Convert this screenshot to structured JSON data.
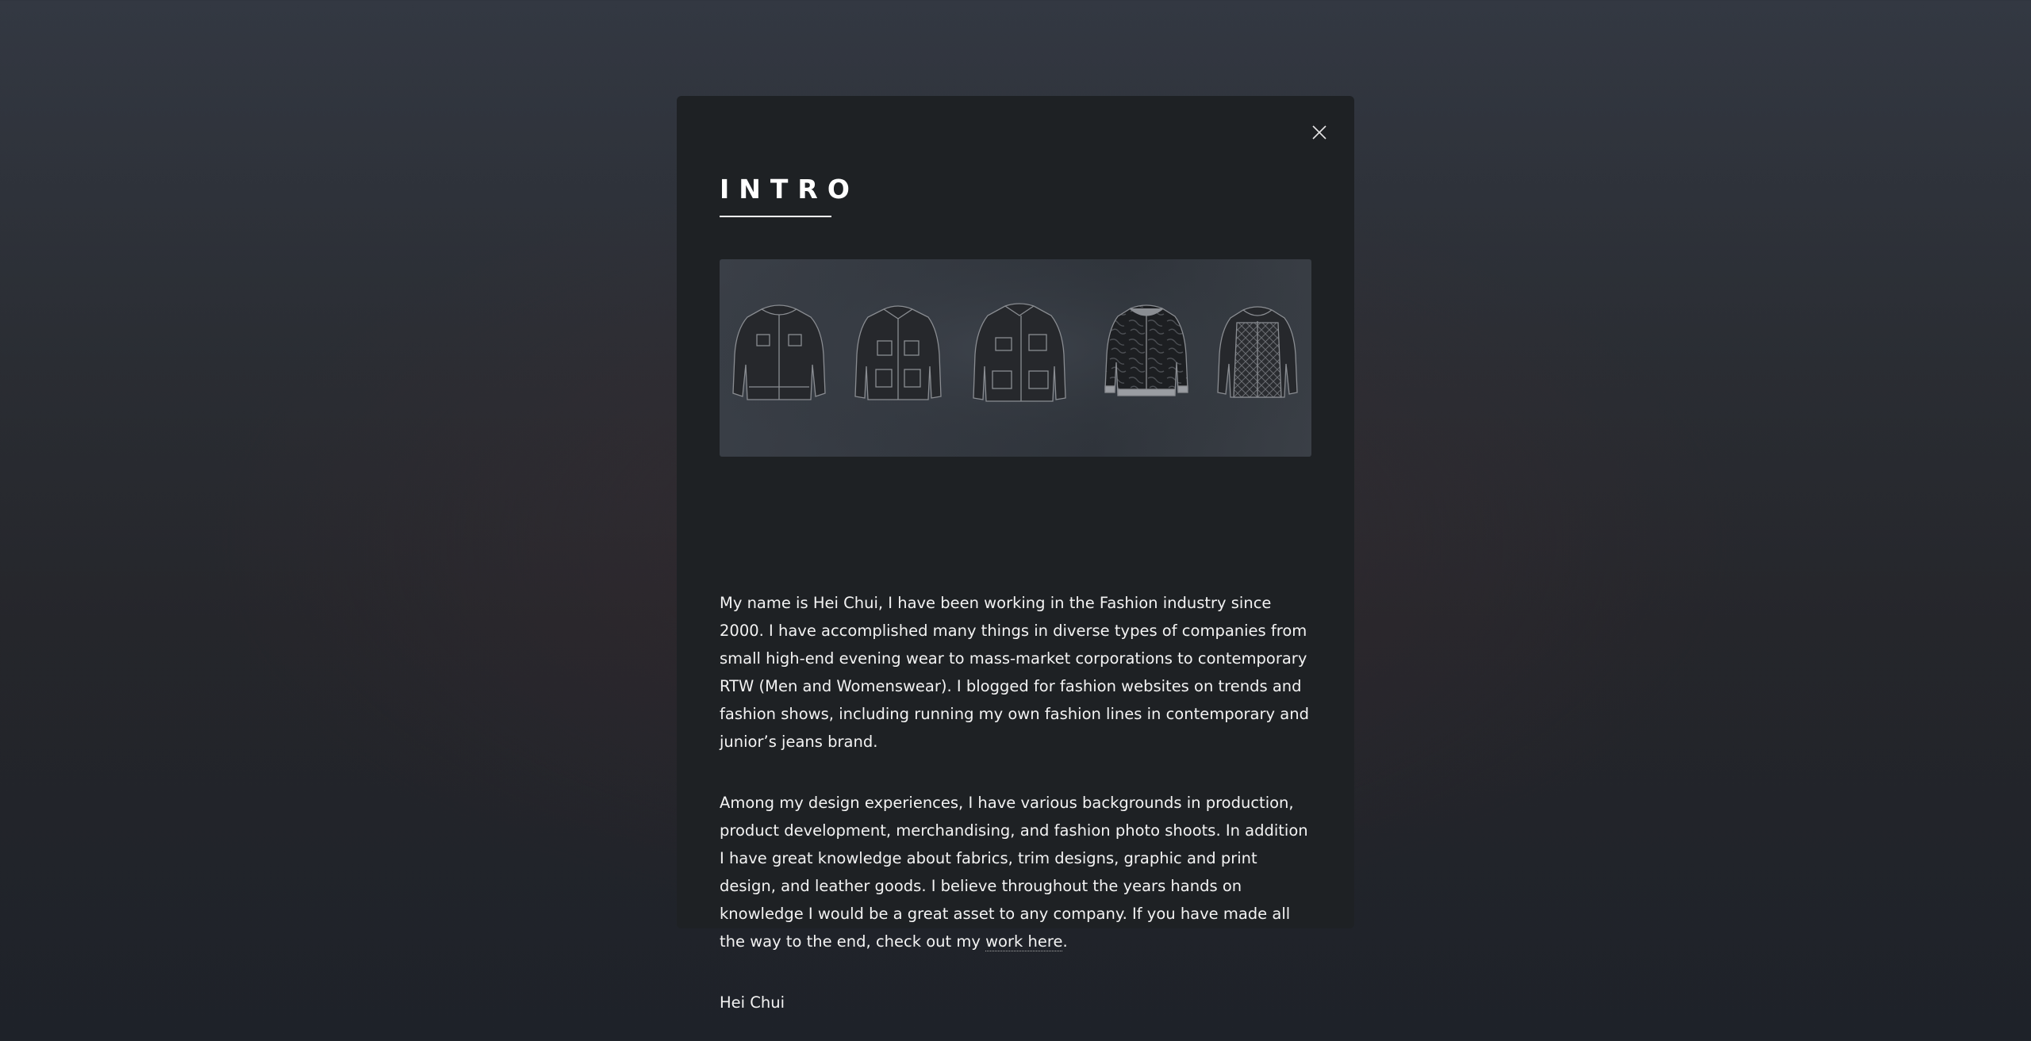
{
  "modal": {
    "title": "INTRO",
    "close_icon": "close-icon",
    "hero_image": "jackets-flat-sketch-illustration",
    "paragraph_1": "My name is Hei Chui, I have been working in the Fashion industry since 2000. I have accomplished many things in diverse types of companies from small high-end evening wear to mass-market corporations to contemporary RTW (Men and Womenswear). I blogged for fashion websites on trends and fashion shows, including running my own fashion lines in contemporary and junior’s jeans brand.",
    "paragraph_2_text": "Among my design experiences, I have various backgrounds in production, product development, merchandising, and fashion photo shoots. In addition I have great knowledge about fabrics, trim designs, graphic and print design, and leather goods. I believe throughout the years hands on knowledge I would be a great asset to any company. If you have made all the way to the end, check out my ",
    "paragraph_2_link": "work here",
    "paragraph_2_end": ".",
    "signature": "Hei Chui"
  },
  "colors": {
    "modal_background": "#1e2124",
    "text": "#f3f3f3",
    "accent": "#ffffff"
  }
}
